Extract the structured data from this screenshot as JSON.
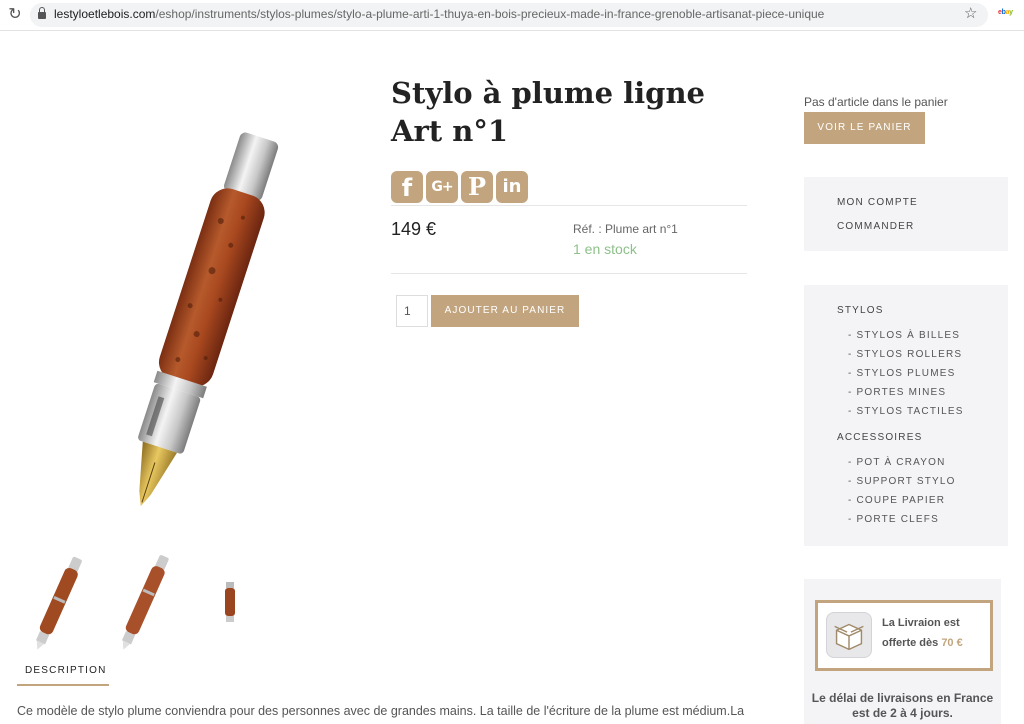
{
  "browser": {
    "url_host": "lestyloetlebois.com",
    "url_path": "/eshop/instruments/stylos-plumes/stylo-a-plume-arti-1-thuya-en-bois-precieux-made-in-france-grenoble-artisanat-piece-unique",
    "extension_label": "ebay"
  },
  "product": {
    "title": "Stylo à plume ligne Art n°1",
    "price": "149 €",
    "ref": "Réf. : Plume art n°1",
    "stock": "1 en stock",
    "quantity": "1",
    "add_to_cart_label": "AJOUTER AU PANIER",
    "share_icons": [
      "facebook-icon",
      "google-plus-icon",
      "pinterest-icon",
      "linkedin-icon"
    ],
    "share_glyphs": {
      "facebook": "f",
      "google_plus": "G+",
      "pinterest": "P",
      "linkedin": "in"
    }
  },
  "tabs": {
    "description_label": "DESCRIPTION"
  },
  "description": {
    "text": "Ce modèle de stylo plume conviendra pour des personnes avec de grandes mains. La taille de l'écriture de la plume est médium.La"
  },
  "cart": {
    "empty_text": "Pas d'article dans le panier",
    "view_cart_label": "VOIR LE PANIER"
  },
  "account_menu": {
    "items": [
      "MON COMPTE",
      "COMMANDER"
    ]
  },
  "categories": {
    "stylos_label": "STYLOS",
    "stylos_items": [
      "- STYLOS À BILLES",
      "- STYLOS ROLLERS",
      "- STYLOS PLUMES",
      "- PORTES MINES",
      "- STYLOS TACTILES"
    ],
    "accessoires_label": "ACCESSOIRES",
    "accessoires_items": [
      "- POT À CRAYON",
      "- SUPPORT STYLO",
      "- COUPE PAPIER",
      "- PORTE CLEFS"
    ]
  },
  "shipping": {
    "line1": "La Livraion est",
    "line2_prefix": "offerte dès",
    "amount": "70 €",
    "note": "Le délai de livraisons en France est de 2 à 4 jours."
  },
  "colors": {
    "accent": "#c2a57f",
    "stock_green": "#8ec08a",
    "sidebar_bg": "#f4f4f7",
    "wood": "#a04a22"
  }
}
